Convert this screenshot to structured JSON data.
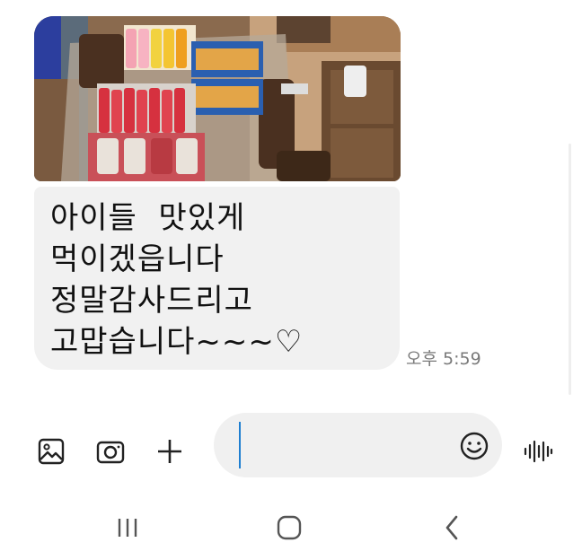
{
  "message": {
    "photo_alt": "",
    "text_lines": [
      "아이들  맛있게",
      "먹이겠읍니다",
      "정말감사드리고",
      "고맙습니다~~~♡"
    ],
    "timestamp": "오후 5:59"
  },
  "composer": {
    "input_value": "",
    "placeholder": "",
    "icons": {
      "gallery": "gallery-icon",
      "camera": "camera-icon",
      "attach": "plus-icon",
      "emoji": "emoji-icon",
      "voice": "voice-record-icon"
    }
  },
  "navbar": {
    "recents": "recent-apps-icon",
    "home": "home-icon",
    "back": "back-icon"
  },
  "colors": {
    "bubble": "#f1f1f1",
    "input": "#f0f0f0",
    "caret": "#1f7fd1",
    "timestamp": "#7a7a7a"
  }
}
